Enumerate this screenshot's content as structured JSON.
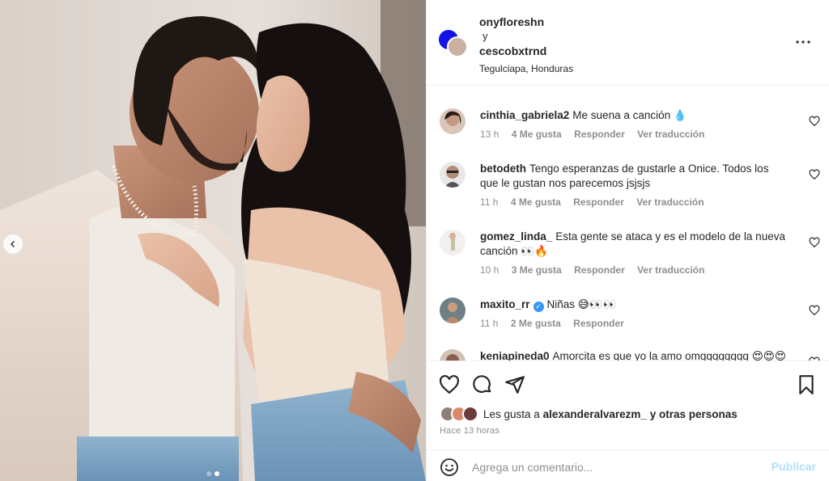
{
  "header": {
    "user1": "onyfloreshn",
    "conj": "y",
    "user2": "cescobxtrnd",
    "location": "Tegulciapa, Honduras"
  },
  "comments": [
    {
      "user": "cinthia_gabriela2",
      "text": "Me suena a canción 💧",
      "time": "13 h",
      "likes": "4 Me gusta",
      "reply": "Responder",
      "translate": "Ver traducción"
    },
    {
      "user": "betodeth",
      "text": "Tengo esperanzas de gustarle a Onice. Todos los que le gustan nos parecemos jsjsjs",
      "time": "11 h",
      "likes": "4 Me gusta",
      "reply": "Responder",
      "translate": "Ver traducción"
    },
    {
      "user": "gomez_linda_",
      "text": "Esta gente se ataca y es el modelo de la nueva canción 👀🔥",
      "time": "10 h",
      "likes": "3 Me gusta",
      "reply": "Responder",
      "translate": "Ver traducción"
    },
    {
      "user": "maxito_rr",
      "text": "Niñas 😅👀👀",
      "time": "11 h",
      "likes": "2 Me gusta",
      "reply": "Responder"
    },
    {
      "user": "keniapineda0",
      "text": "Amorcita es que yo la amo omgggggggg 😍😍😍"
    }
  ],
  "likes": {
    "prefix": "Les gusta a",
    "user": "alexanderalvarezm_",
    "suffix": "y otras personas"
  },
  "time_ago": "Hace 13 horas",
  "add_comment": {
    "placeholder": "Agrega un comentario...",
    "publish": "Publicar"
  },
  "icons": {
    "more": "more-horizontal-icon",
    "like": "heart-icon",
    "comment": "comment-icon",
    "share": "send-icon",
    "save": "bookmark-icon",
    "emoji": "emoji-icon",
    "prev": "chevron-left-icon"
  },
  "carousel": {
    "count": 2,
    "active": 2
  },
  "colors": {
    "publish_disabled": "#b2dffc",
    "verified": "#3897f0",
    "meta": "#8e8e8e"
  }
}
